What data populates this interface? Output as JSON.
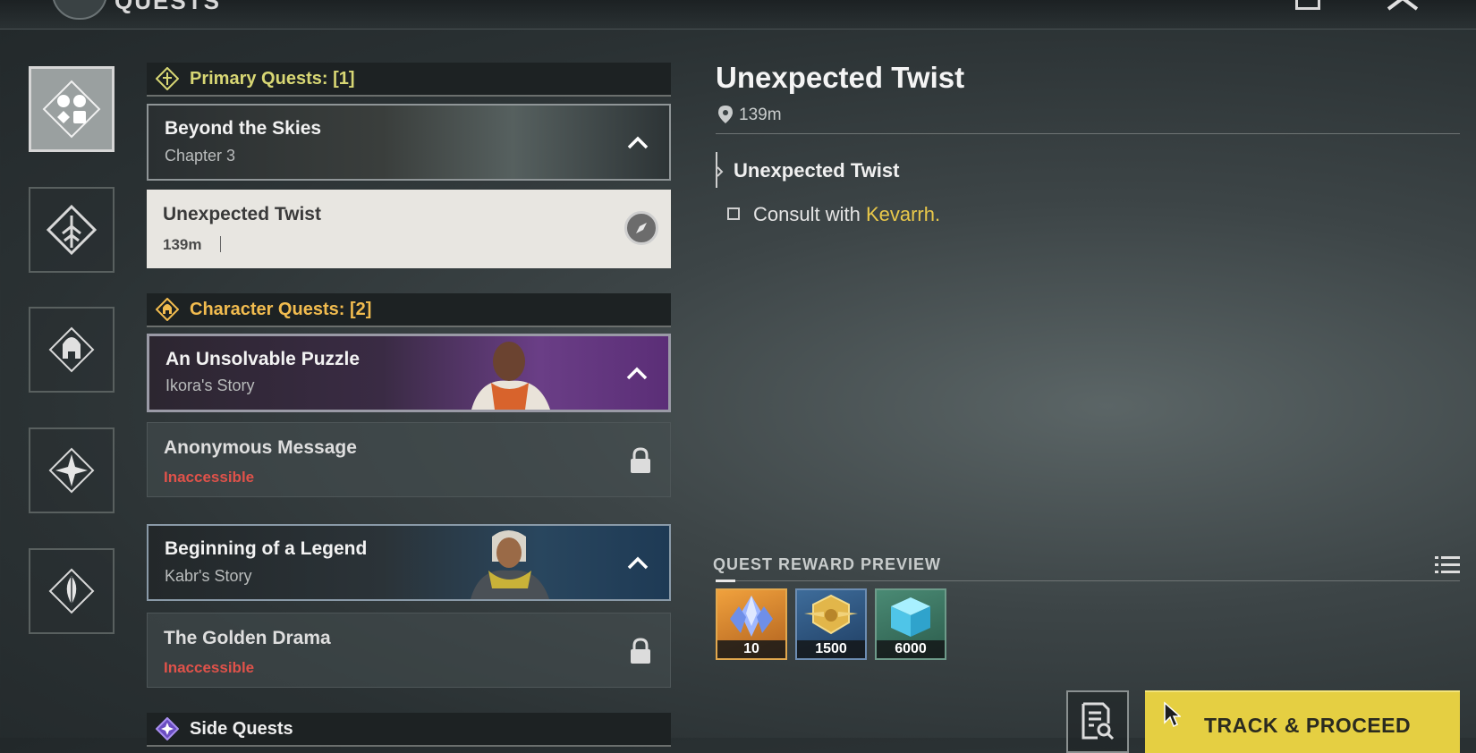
{
  "header": {
    "title": "QUESTS"
  },
  "primary": {
    "header": "Primary Quests: [1]",
    "group": {
      "title": "Beyond the Skies",
      "subtitle": "Chapter 3"
    },
    "quest": {
      "title": "Unexpected Twist",
      "distance": "139m"
    }
  },
  "character": {
    "header": "Character Quests: [2]",
    "groups": [
      {
        "title": "An Unsolvable Puzzle",
        "subtitle": "Ikora's Story",
        "quest": {
          "title": "Anonymous Message",
          "status": "Inaccessible"
        }
      },
      {
        "title": "Beginning of a Legend",
        "subtitle": "Kabr's Story",
        "quest": {
          "title": "The Golden Drama",
          "status": "Inaccessible"
        }
      }
    ]
  },
  "side": {
    "header": "Side Quests"
  },
  "detail": {
    "title": "Unexpected Twist",
    "distance": "139m",
    "step": "Unexpected Twist",
    "objective_prefix": "Consult with ",
    "objective_name": "Kevarrh",
    "objective_suffix": "."
  },
  "rewards": {
    "header": "QUEST REWARD PREVIEW",
    "items": [
      {
        "icon": "crystal-icon",
        "count": "10",
        "color": "#d9892f"
      },
      {
        "icon": "gold-emblem-icon",
        "count": "1500",
        "color": "#2e5c8a"
      },
      {
        "icon": "cube-icon",
        "count": "6000",
        "color": "#3f7a67"
      }
    ]
  },
  "actions": {
    "track": "TRACK & PROCEED"
  },
  "colors": {
    "accent": "#e5cf42",
    "primary_header": "#d8d774",
    "character_header": "#f2bc4f",
    "inaccessible": "#e0524a"
  }
}
